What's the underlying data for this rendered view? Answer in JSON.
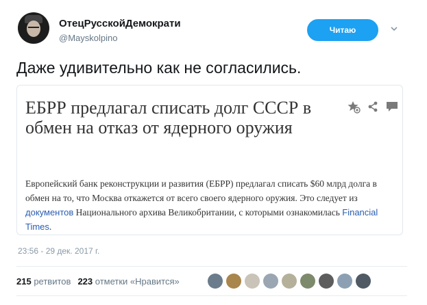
{
  "user": {
    "name": "ОтецРусскойДемократи",
    "handle": "@Mayskolpino"
  },
  "follow_button": {
    "label": "Читаю"
  },
  "tweet": {
    "text": "Даже удивительно как не согласились."
  },
  "card": {
    "title": "ЕБРР предлагал списать долг СССР в обмен на отказ от ядерного оружия",
    "body_part1": "Европейский банк реконструкции и развития (ЕБРР) предлагал списать $60 млрд долга в обмен на то, что Москва откажется от всего своего ядерного оружия. Это следует из ",
    "body_link1": "документов",
    "body_part2": " Национального архива Великобритании, с которыми ознакомилась ",
    "body_link2": "Financial Times",
    "body_part3": ".",
    "icons": [
      "bookmark-star-icon",
      "share-icon",
      "comment-icon"
    ]
  },
  "timestamp": "23:56 - 29 дек. 2017 г.",
  "stats": {
    "retweets_count": "215",
    "retweets_label": "ретвитов",
    "likes_count": "223",
    "likes_label": "отметки «Нравится»"
  },
  "likers_colors": [
    "#6b7c8c",
    "#a8864c",
    "#c9c3b8",
    "#9aa6b2",
    "#b5b09a",
    "#7d8a6c",
    "#5d5d5d",
    "#8da0b3",
    "#4f5a64"
  ]
}
